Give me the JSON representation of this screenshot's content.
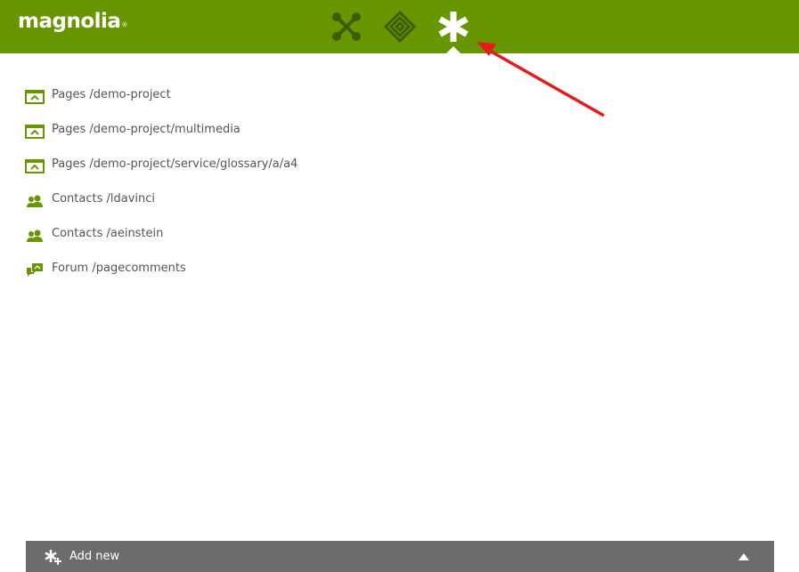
{
  "header": {
    "logo_text": "magnolia",
    "logo_mark": "®",
    "apps": [
      {
        "name": "app-launcher",
        "icon": "cross-nodes-icon",
        "active": false
      },
      {
        "name": "pulse",
        "icon": "diamond-layers-icon",
        "active": false
      },
      {
        "name": "favorites",
        "icon": "asterisk-icon",
        "active": true
      }
    ],
    "bar_color": "#689600"
  },
  "favorites": [
    {
      "icon": "page-icon",
      "label": "Pages /demo-project"
    },
    {
      "icon": "page-icon",
      "label": "Pages /demo-project/multimedia"
    },
    {
      "icon": "page-icon",
      "label": "Pages /demo-project/service/glossary/a/a4"
    },
    {
      "icon": "contacts-icon",
      "label": "Contacts /ldavinci"
    },
    {
      "icon": "contacts-icon",
      "label": "Contacts /aeinstein"
    },
    {
      "icon": "forum-icon",
      "label": "Forum /pagecomments"
    }
  ],
  "footer": {
    "add_new_label": "Add new",
    "icon": "add-favorite-icon",
    "toggle_icon": "triangle-up-icon"
  },
  "annotation": {
    "arrow_color": "#e31c1c"
  }
}
